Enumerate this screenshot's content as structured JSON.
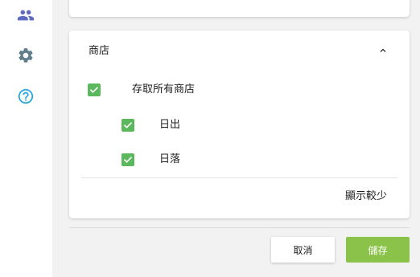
{
  "colors": {
    "accent_green": "#5cb85c",
    "save_button": "#8bc34a",
    "people_icon": "#5c6bc0",
    "gear_icon": "#607d8b",
    "help_icon": "#29a8e0"
  },
  "sidebar": {
    "items": [
      {
        "icon": "people-icon"
      },
      {
        "icon": "gear-icon"
      },
      {
        "icon": "help-circle-icon"
      }
    ]
  },
  "stores": {
    "title": "商店",
    "collapse_icon": "chevron-up-icon",
    "access_all": {
      "label": "存取所有商店",
      "checked": true
    },
    "items": [
      {
        "label": "日出",
        "checked": true
      },
      {
        "label": "日落",
        "checked": true
      }
    ],
    "show_less_label": "顯示較少"
  },
  "footer": {
    "cancel_label": "取消",
    "save_label": "儲存"
  }
}
